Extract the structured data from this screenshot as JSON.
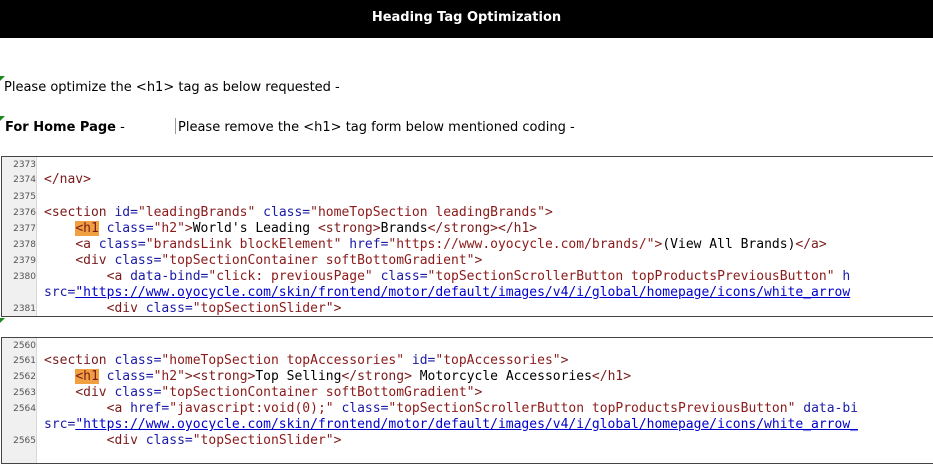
{
  "header": {
    "title": "Heading Tag Optimization"
  },
  "intro": "Please optimize the <h1> tag as below requested -",
  "home_label": "For Home Page",
  "home_dash": " -",
  "remove_text": "Please remove the <h1> tag form below mentioned coding -",
  "code1": {
    "lines": [
      {
        "n": "2373",
        "segs": []
      },
      {
        "n": "2374",
        "segs": [
          {
            "c": "t",
            "v": "</nav>"
          }
        ]
      },
      {
        "n": "2375",
        "segs": []
      },
      {
        "n": "2376",
        "segs": [
          {
            "c": "t",
            "v": "<section"
          },
          {
            "c": "a",
            "v": " id="
          },
          {
            "c": "s",
            "v": "\"leadingBrands\""
          },
          {
            "c": "a",
            "v": " class="
          },
          {
            "c": "s",
            "v": "\"homeTopSection leadingBrands\""
          },
          {
            "c": "t",
            "v": ">"
          }
        ]
      },
      {
        "n": "2377",
        "segs": [
          {
            "c": "p",
            "v": "    "
          },
          {
            "c": "hl",
            "v": "<h1"
          },
          {
            "c": "a",
            "v": " class="
          },
          {
            "c": "s",
            "v": "\"h2\""
          },
          {
            "c": "t",
            "v": ">"
          },
          {
            "c": "p",
            "v": "World's Leading "
          },
          {
            "c": "t",
            "v": "<strong>"
          },
          {
            "c": "p",
            "v": "Brands"
          },
          {
            "c": "t",
            "v": "</strong></h1>"
          }
        ]
      },
      {
        "n": "2378",
        "segs": [
          {
            "c": "p",
            "v": "    "
          },
          {
            "c": "t",
            "v": "<a"
          },
          {
            "c": "a",
            "v": " class="
          },
          {
            "c": "s",
            "v": "\"brandsLink blockElement\""
          },
          {
            "c": "a",
            "v": " href="
          },
          {
            "c": "s",
            "v": "\"https://www.oyocycle.com/brands/\""
          },
          {
            "c": "t",
            "v": ">"
          },
          {
            "c": "p",
            "v": "(View All Brands)"
          },
          {
            "c": "t",
            "v": "</a>"
          }
        ]
      },
      {
        "n": "2379",
        "segs": [
          {
            "c": "p",
            "v": "    "
          },
          {
            "c": "t",
            "v": "<div"
          },
          {
            "c": "a",
            "v": " class="
          },
          {
            "c": "s",
            "v": "\"topSectionContainer softBottomGradient\""
          },
          {
            "c": "t",
            "v": ">"
          }
        ]
      },
      {
        "n": "2380",
        "segs": [
          {
            "c": "p",
            "v": "        "
          },
          {
            "c": "t",
            "v": "<a"
          },
          {
            "c": "a",
            "v": " data-bind="
          },
          {
            "c": "s",
            "v": "\"click: previousPage\""
          },
          {
            "c": "a",
            "v": " class="
          },
          {
            "c": "s",
            "v": "\"topSectionScrollerButton topProductsPreviousButton\""
          },
          {
            "c": "a",
            "v": " h"
          }
        ]
      },
      {
        "n": "",
        "segs": [
          {
            "c": "a",
            "v": "src="
          },
          {
            "c": "u",
            "v": "\"https://www.oyocycle.com/skin/frontend/motor/default/images/v4/i/global/homepage/icons/white_arrow"
          }
        ]
      },
      {
        "n": "2381",
        "segs": [
          {
            "c": "p",
            "v": "        "
          },
          {
            "c": "t",
            "v": "<div"
          },
          {
            "c": "a",
            "v": " class="
          },
          {
            "c": "s",
            "v": "\"topSectionSlider\""
          },
          {
            "c": "t",
            "v": ">"
          }
        ]
      }
    ]
  },
  "code2": {
    "lines": [
      {
        "n": "2560",
        "segs": []
      },
      {
        "n": "2561",
        "segs": [
          {
            "c": "t",
            "v": "<section"
          },
          {
            "c": "a",
            "v": " class="
          },
          {
            "c": "s",
            "v": "\"homeTopSection topAccessories\""
          },
          {
            "c": "a",
            "v": " id="
          },
          {
            "c": "s",
            "v": "\"topAccessories\""
          },
          {
            "c": "t",
            "v": ">"
          }
        ]
      },
      {
        "n": "2562",
        "segs": [
          {
            "c": "p",
            "v": "    "
          },
          {
            "c": "hl",
            "v": "<h1"
          },
          {
            "c": "a",
            "v": " class="
          },
          {
            "c": "s",
            "v": "\"h2\""
          },
          {
            "c": "t",
            "v": "><strong>"
          },
          {
            "c": "p",
            "v": "Top Selling"
          },
          {
            "c": "t",
            "v": "</strong>"
          },
          {
            "c": "p",
            "v": " Motorcycle Accessories"
          },
          {
            "c": "t",
            "v": "</h1>"
          }
        ]
      },
      {
        "n": "2563",
        "segs": [
          {
            "c": "p",
            "v": "    "
          },
          {
            "c": "t",
            "v": "<div"
          },
          {
            "c": "a",
            "v": " class="
          },
          {
            "c": "s",
            "v": "\"topSectionContainer softBottomGradient\""
          },
          {
            "c": "t",
            "v": ">"
          }
        ]
      },
      {
        "n": "2564",
        "segs": [
          {
            "c": "p",
            "v": "        "
          },
          {
            "c": "t",
            "v": "<a"
          },
          {
            "c": "a",
            "v": " href="
          },
          {
            "c": "s",
            "v": "\"javascript:void(0);\""
          },
          {
            "c": "a",
            "v": " class="
          },
          {
            "c": "s",
            "v": "\"topSectionScrollerButton topProductsPreviousButton\""
          },
          {
            "c": "a",
            "v": " data-bi"
          }
        ]
      },
      {
        "n": "",
        "segs": [
          {
            "c": "a",
            "v": "src="
          },
          {
            "c": "u",
            "v": "\"https://www.oyocycle.com/skin/frontend/motor/default/images/v4/i/global/homepage/icons/white_arrow_"
          }
        ]
      },
      {
        "n": "2565",
        "segs": [
          {
            "c": "p",
            "v": "        "
          },
          {
            "c": "t",
            "v": "<div"
          },
          {
            "c": "a",
            "v": " class="
          },
          {
            "c": "s",
            "v": "\"topSectionSlider\""
          },
          {
            "c": "t",
            "v": ">"
          }
        ]
      }
    ]
  }
}
